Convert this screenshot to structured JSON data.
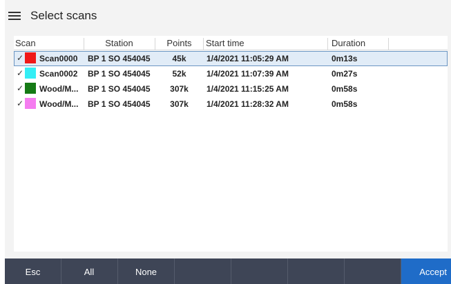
{
  "header": {
    "title": "Select scans"
  },
  "table": {
    "columns": [
      "Scan",
      "Station",
      "Points",
      "Start time",
      "Duration"
    ],
    "rows": [
      {
        "checked": "✓",
        "color": "#f01818",
        "scan": "Scan0000",
        "station": "BP 1 SO 454045",
        "points": "45k",
        "start_time": "1/4/2021 11:05:29 AM",
        "duration": "0m13s",
        "selected": true
      },
      {
        "checked": "✓",
        "color": "#34eef5",
        "scan": "Scan0002",
        "station": "BP 1 SO 454045",
        "points": "52k",
        "start_time": "1/4/2021 11:07:39 AM",
        "duration": "0m27s",
        "selected": false
      },
      {
        "checked": "✓",
        "color": "#157a15",
        "scan": "Wood/M...",
        "station": "BP 1 SO 454045",
        "points": "307k",
        "start_time": "1/4/2021 11:15:25 AM",
        "duration": "0m58s",
        "selected": false
      },
      {
        "checked": "✓",
        "color": "#f57cf0",
        "scan": "Wood/M...",
        "station": "BP 1 SO 454045",
        "points": "307k",
        "start_time": "1/4/2021 11:28:32 AM",
        "duration": "0m58s",
        "selected": false
      }
    ]
  },
  "footer": {
    "esc_label": "Esc",
    "all_label": "All",
    "none_label": "None",
    "accept_label": "Accept"
  },
  "colors": {
    "footer_bg": "#3e4556",
    "accept_bg": "#1f6cc8",
    "selection_bg": "#e1ecf7",
    "selection_border": "#6a95c2"
  }
}
